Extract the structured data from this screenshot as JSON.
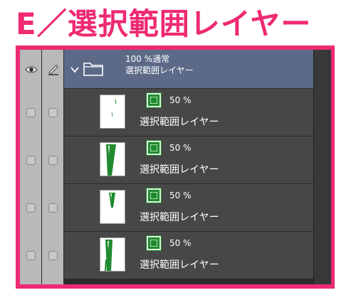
{
  "title": "E／選択範囲レイヤー",
  "colors": {
    "accent": "#ee2a72",
    "folder_row": "#5c6a88",
    "layer_row": "#474747",
    "mask_green": "#1f8a2e"
  },
  "header": {
    "visibility_icon": "eye-icon",
    "lock_icon": "pen-icon"
  },
  "folder": {
    "expand_icon": "chevron-down-icon",
    "icon": "folder-icon",
    "opacity_blend": "100 %通常",
    "name": "選択範囲レイヤー"
  },
  "layers": [
    {
      "opacity": "50 %",
      "name": "選択範囲レイヤー",
      "icon": "selection-mask-icon"
    },
    {
      "opacity": "50 %",
      "name": "選択範囲レイヤー",
      "icon": "selection-mask-icon"
    },
    {
      "opacity": "50 %",
      "name": "選択範囲レイヤー",
      "icon": "selection-mask-icon"
    },
    {
      "opacity": "50 %",
      "name": "選択範囲レイヤー",
      "icon": "selection-mask-icon"
    }
  ]
}
